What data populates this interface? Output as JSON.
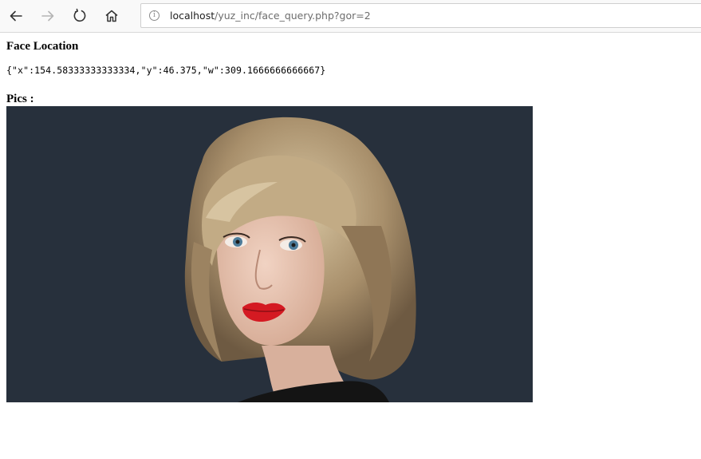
{
  "browser": {
    "url_host": "localhost",
    "url_path": "/yuz_inc/face_query.php?gor=2",
    "buttons": [
      "back-icon",
      "forward-icon",
      "refresh-icon",
      "home-icon"
    ]
  },
  "page": {
    "face_heading": "Face Location",
    "face_json": "{\"x\":154.58333333333334,\"y\":46.375,\"w\":309.1666666666667}",
    "pics_heading": "Pics :"
  },
  "colors": {
    "photo_background": "#27303c",
    "hair": "#b8a27f",
    "lips": "#d41a22",
    "eyes": "#4d7c9a"
  }
}
